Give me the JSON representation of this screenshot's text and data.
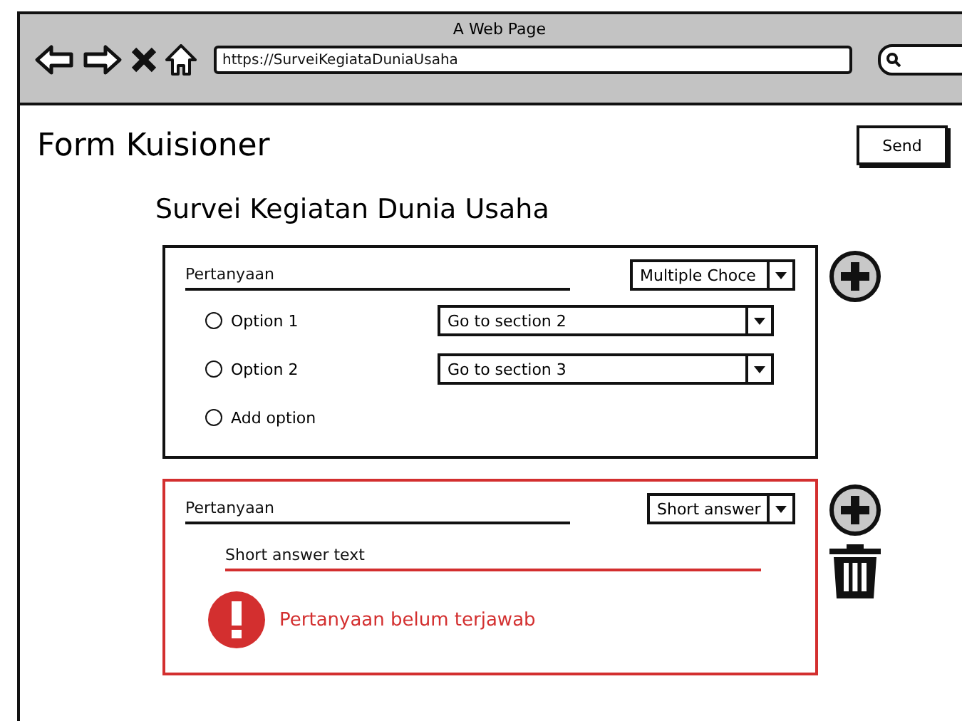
{
  "window": {
    "title": "A Web Page",
    "url": "https://SurveiKegiataDuniaUsaha"
  },
  "page": {
    "title": "Form Kuisioner",
    "send_button": "Send",
    "form_title": "Survei Kegiatan Dunia Usaha"
  },
  "questions": [
    {
      "kind": "choice",
      "placeholder": "Pertanyaan",
      "type": "Multiple Choce",
      "error": false,
      "deletable": false,
      "options": [
        {
          "kind": "option",
          "label": "Option 1",
          "selected": false,
          "target": "Go to section 2"
        },
        {
          "kind": "option",
          "label": "Option 2",
          "selected": false,
          "target": "Go to section 3"
        },
        {
          "kind": "add",
          "label": "Add option",
          "selected": false
        }
      ]
    },
    {
      "kind": "short",
      "placeholder": "Pertanyaan",
      "type": "Short answer",
      "error": true,
      "deletable": true,
      "answer_placeholder": "Short answer text",
      "message": "Pertanyaan belum terjawab"
    }
  ]
}
